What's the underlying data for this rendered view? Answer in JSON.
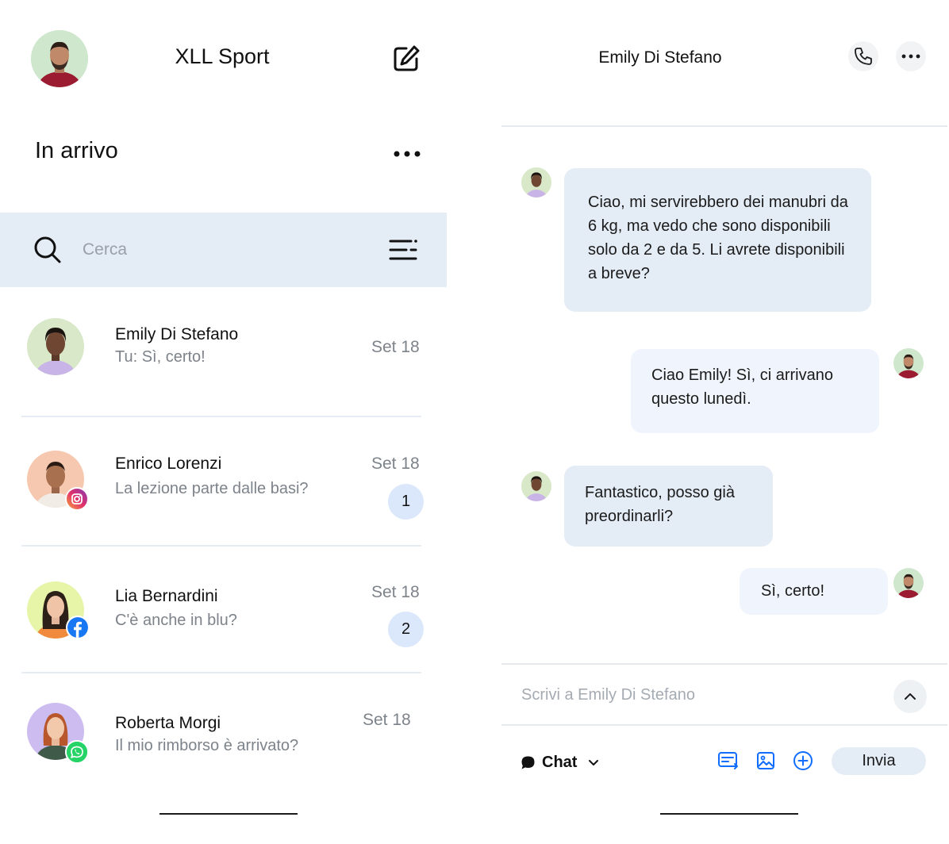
{
  "inbox": {
    "app_title": "XLL Sport",
    "section_title": "In arrivo",
    "search_placeholder": "Cerca",
    "conversations": [
      {
        "name": "Emily Di Stefano",
        "preview": "Tu: Sì, certo!",
        "date": "Set 18",
        "unread": "",
        "channel": ""
      },
      {
        "name": "Enrico Lorenzi",
        "preview": "La lezione parte dalle basi?",
        "date": "Set 18",
        "unread": "1",
        "channel": "instagram"
      },
      {
        "name": "Lia Bernardini",
        "preview": "C'è anche in blu?",
        "date": "Set 18",
        "unread": "2",
        "channel": "facebook"
      },
      {
        "name": "Roberta Morgi",
        "preview": "Il mio rimborso è arrivato?",
        "date": "Set 18",
        "unread": "",
        "channel": "whatsapp"
      }
    ]
  },
  "chat": {
    "contact_name": "Emily Di Stefano",
    "messages": [
      {
        "from": "contact",
        "text": "Ciao, mi servirebbero dei manubri da 6 kg, ma vedo che sono disponibili solo da 2 e da 5. Li avrete disponibili a breve?"
      },
      {
        "from": "me",
        "text": "Ciao Emily! Sì, ci arrivano questo lunedì."
      },
      {
        "from": "contact",
        "text": "Fantastico, posso già preordinarli?"
      },
      {
        "from": "me",
        "text": "Sì, certo!"
      }
    ],
    "composer_placeholder": "Scrivi a Emily Di Stefano",
    "channel_label": "Chat",
    "send_label": "Invia"
  },
  "icons": {
    "compose": "edit-square-icon",
    "more": "ellipsis-icon",
    "search": "search-icon",
    "filter": "filter-icon",
    "phone": "phone-icon",
    "chevron_up": "chevron-up-icon",
    "chevron_down": "chevron-down-icon",
    "chat_bubble": "chat-bubble-icon",
    "saved_replies": "saved-replies-icon",
    "image": "image-icon",
    "add": "plus-circle-icon"
  },
  "colors": {
    "accent": "#116dff",
    "search_bg": "#e4ecf6",
    "incoming_bubble": "#e4ecf6",
    "outgoing_bubble": "#f0f5fd",
    "unread_badge": "#dbe8fb",
    "muted_text": "#7d838a"
  }
}
